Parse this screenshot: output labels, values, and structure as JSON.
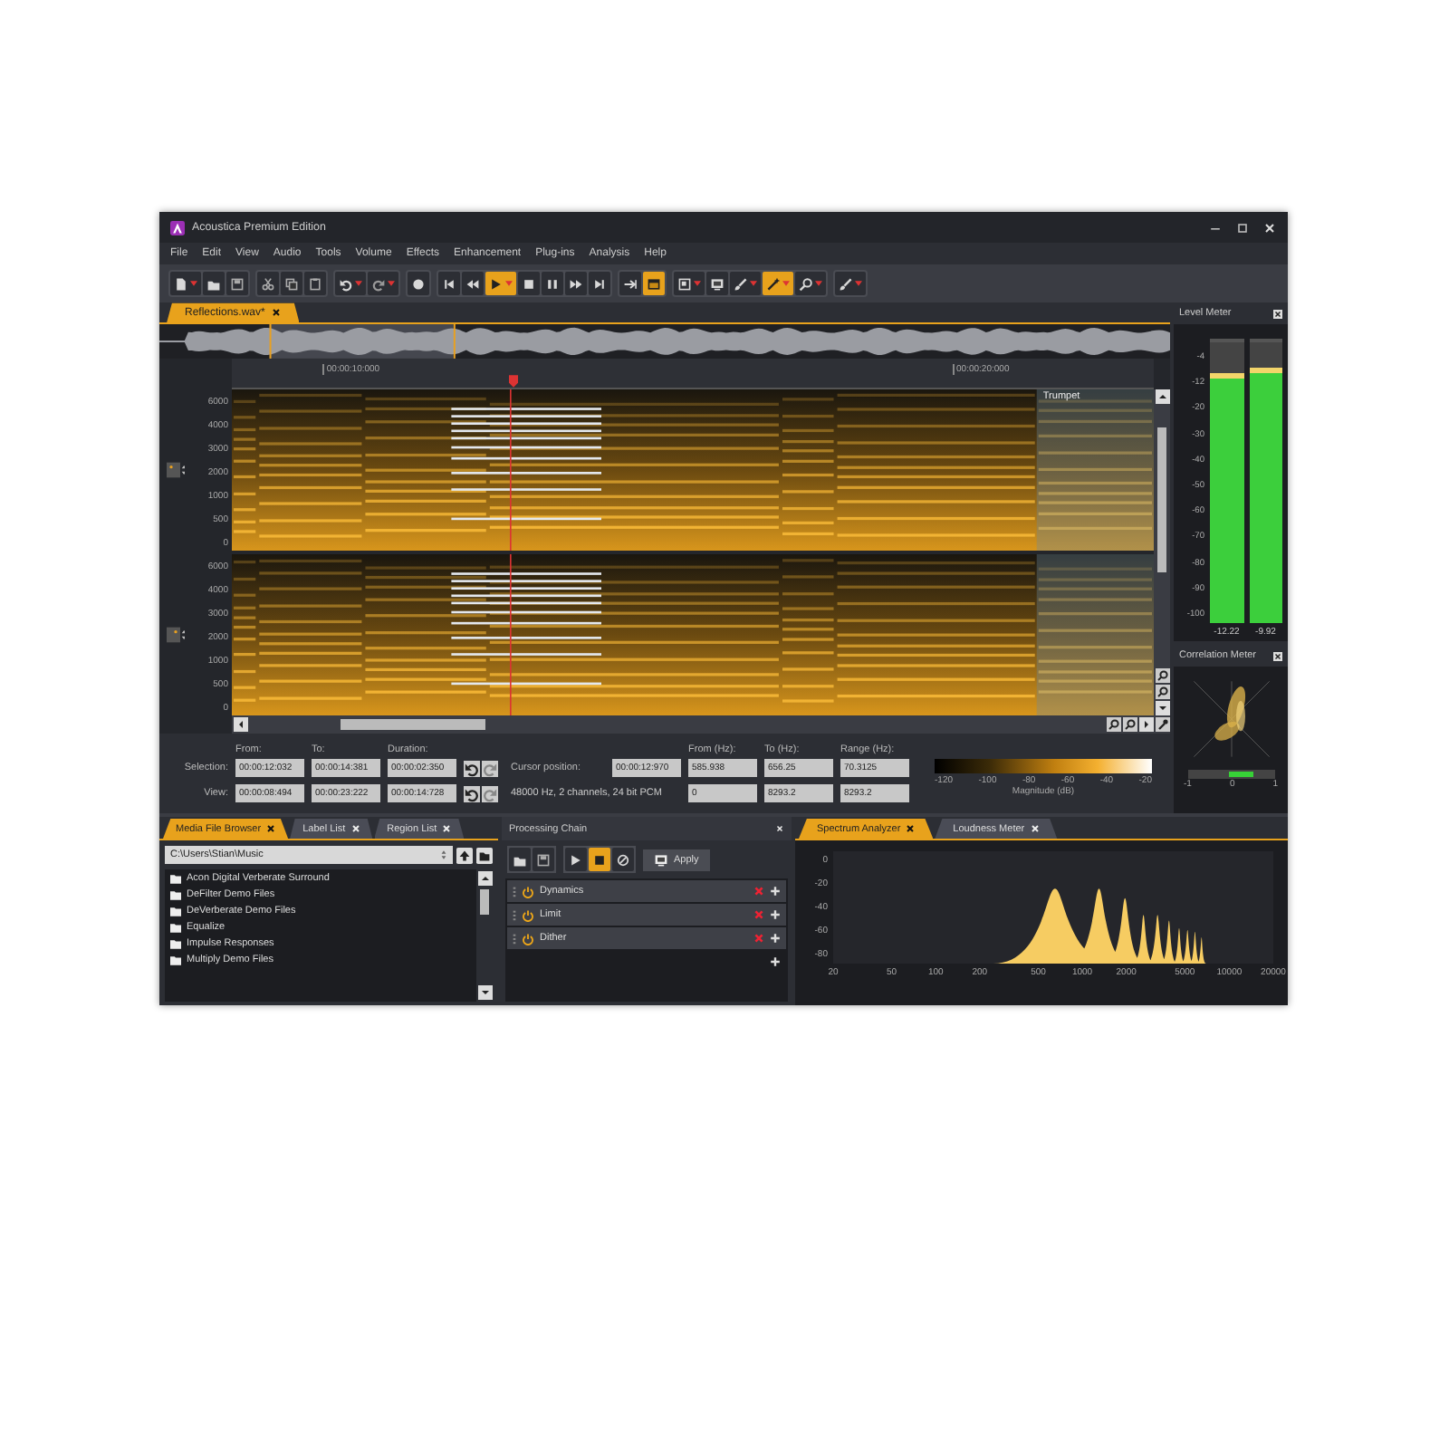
{
  "window": {
    "title": "Acoustica Premium Edition"
  },
  "menu": [
    "File",
    "Edit",
    "View",
    "Audio",
    "Tools",
    "Volume",
    "Effects",
    "Enhancement",
    "Plug-ins",
    "Analysis",
    "Help"
  ],
  "toolbar": [
    {
      "active": false
    },
    {
      "active": false
    },
    {
      "active": false
    },
    {
      "active": false
    },
    {
      "active": false
    },
    {
      "active": false
    },
    {
      "active": false
    },
    {
      "active": false
    },
    {
      "active": false
    },
    {
      "active": false
    },
    {
      "active": false
    },
    {
      "active": true
    },
    {
      "active": false
    },
    {
      "active": false
    },
    {
      "active": false
    },
    {
      "active": false
    },
    {
      "active": false
    },
    {
      "active": true
    },
    {
      "active": false
    },
    {
      "active": false
    },
    {
      "active": false
    },
    {
      "active": true
    },
    {
      "active": false
    },
    {
      "active": false
    }
  ],
  "document_tab": {
    "label": "Reflections.wav*",
    "selected": true
  },
  "timeline": [
    "00:00:10:000",
    "00:00:20:000"
  ],
  "channels": [
    {
      "frequency_labels": [
        "6000",
        "4000",
        "3000",
        "2000",
        "1000",
        "500",
        "0"
      ]
    },
    {
      "frequency_labels": [
        "6000",
        "4000",
        "3000",
        "2000",
        "1000",
        "500",
        "0"
      ]
    }
  ],
  "region_label": "Trumpet",
  "selection_panel": {
    "headers": [
      "From:",
      "To:",
      "Duration:"
    ],
    "rows": [
      {
        "label": "Selection:",
        "from": "00:00:12:032",
        "to": "00:00:14:381",
        "duration": "00:00:02:350"
      },
      {
        "label": "View:",
        "from": "00:00:08:494",
        "to": "00:00:23:222",
        "duration": "00:00:14:728"
      }
    ],
    "cursor_label": "Cursor position:",
    "cursor_value": "00:00:12:970",
    "format": "48000 Hz, 2 channels, 24 bit PCM",
    "hz_headers": [
      "From (Hz):",
      "To (Hz):",
      "Range (Hz):"
    ],
    "hz_rows": [
      [
        "585.938",
        "656.25",
        "70.3125"
      ],
      [
        "0",
        "8293.2",
        "8293.2"
      ]
    ],
    "colorbar_ticks": [
      "-120",
      "-100",
      "-80",
      "-60",
      "-40",
      "-20"
    ],
    "colorbar_caption": "Magnitude (dB)"
  },
  "level_meter": {
    "title": "Level Meter",
    "scale": [
      "-4",
      "-12",
      "-20",
      "-30",
      "-40",
      "-50",
      "-60",
      "-70",
      "-80",
      "-90",
      "-100"
    ],
    "bars": [
      {
        "level": 0.87,
        "reading": "-12.22"
      },
      {
        "level": 0.89,
        "reading": "-9.92"
      }
    ]
  },
  "correlation_meter": {
    "title": "Correlation Meter",
    "level": 0.75,
    "ticks": [
      "-1",
      "0",
      "1"
    ]
  },
  "browser": {
    "tabs": [
      {
        "label": "Media File Browser",
        "selected": true
      },
      {
        "label": "Label List",
        "selected": false
      },
      {
        "label": "Region List",
        "selected": false
      }
    ],
    "path": "C:\\Users\\Stian\\Music",
    "files": [
      "Acon Digital Verberate Surround",
      "DeFilter Demo Files",
      "DeVerberate Demo Files",
      "Equalize",
      "Impulse Responses",
      "Multiply Demo Files"
    ]
  },
  "processing_chain": {
    "title": "Processing Chain",
    "toolbar": [
      {
        "active": false
      },
      {
        "active": false
      },
      {
        "active": false
      },
      {
        "active": true
      },
      {
        "active": false
      }
    ],
    "apply": "Apply",
    "items": [
      {
        "name": "Dynamics",
        "on": true
      },
      {
        "name": "Limit",
        "on": true
      },
      {
        "name": "Dither",
        "on": true
      }
    ]
  },
  "analyzer": {
    "tabs": [
      {
        "label": "Spectrum Analyzer",
        "selected": true
      },
      {
        "label": "Loudness Meter",
        "selected": false
      }
    ],
    "yticks": [
      "0",
      "-20",
      "-40",
      "-60",
      "-80"
    ],
    "xticks": [
      "20",
      "50",
      "100",
      "200",
      "500",
      "1000",
      "2000",
      "5000",
      "10000",
      "20000"
    ]
  }
}
